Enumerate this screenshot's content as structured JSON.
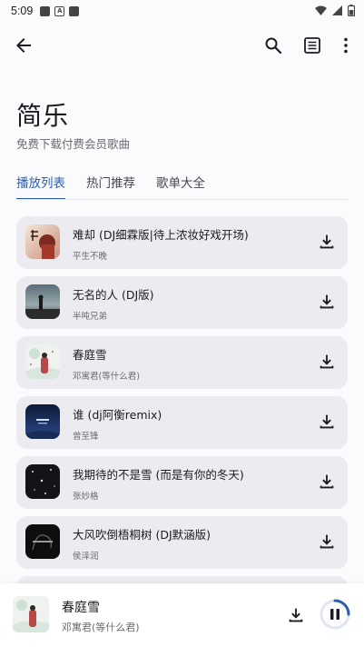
{
  "status_bar": {
    "time": "5:09"
  },
  "header": {
    "title": "简乐",
    "subtitle": "免费下载付费会员歌曲"
  },
  "tabs": [
    {
      "label": "播放列表",
      "active": true
    },
    {
      "label": "热门推荐",
      "active": false
    },
    {
      "label": "歌单大全",
      "active": false
    }
  ],
  "songs": [
    {
      "title": "难却 (DJ细霖版|待上浓妆好戏开场)",
      "artist": "平生不晚"
    },
    {
      "title": "无名的人 (DJ版)",
      "artist": "半吨兄弟"
    },
    {
      "title": "春庭雪",
      "artist": "邓寓君(等什么君)"
    },
    {
      "title": "谁 (dj阿衡remix)",
      "artist": "曾至锋"
    },
    {
      "title": "我期待的不是雪 (而是有你的冬天)",
      "artist": "张妙格"
    },
    {
      "title": "大风吹倒梧桐树 (DJ默涵版)",
      "artist": "侯泽润"
    }
  ],
  "player": {
    "title": "春庭雪",
    "artist": "邓寓君(等什么君)",
    "progress": 0.25
  },
  "colors": {
    "accent": "#2f5fa8",
    "card": "#ecebef",
    "background": "#fbfafc"
  }
}
